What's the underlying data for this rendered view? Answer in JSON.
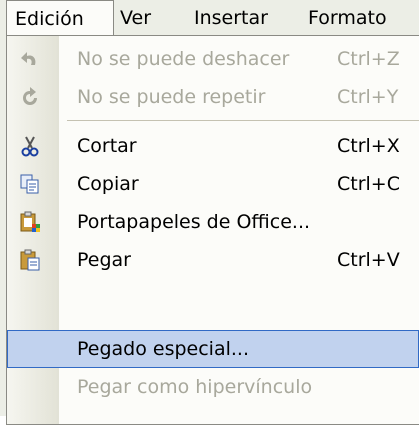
{
  "menubar": {
    "items": [
      {
        "label": "Edición"
      },
      {
        "label": "Ver"
      },
      {
        "label": "Insertar"
      },
      {
        "label": "Formato"
      }
    ]
  },
  "menu": {
    "items": [
      {
        "label": "No se puede deshacer",
        "shortcut": "Ctrl+Z",
        "icon": "undo-icon",
        "enabled": false
      },
      {
        "label": "No se puede repetir",
        "shortcut": "Ctrl+Y",
        "icon": "redo-icon",
        "enabled": false
      },
      {
        "label": "Cortar",
        "shortcut": "Ctrl+X",
        "icon": "scissors-icon",
        "enabled": true
      },
      {
        "label": "Copiar",
        "shortcut": "Ctrl+C",
        "icon": "copy-icon",
        "enabled": true
      },
      {
        "label": "Portapapeles de Office...",
        "shortcut": "",
        "icon": "office-clipboard-icon",
        "enabled": true
      },
      {
        "label": "Pegar",
        "shortcut": "Ctrl+V",
        "icon": "paste-icon",
        "enabled": true
      },
      {
        "label": "Pegado especial...",
        "shortcut": "",
        "icon": "",
        "enabled": true,
        "highlighted": true
      },
      {
        "label": "Pegar como hipervínculo",
        "shortcut": "",
        "icon": "",
        "enabled": false
      }
    ]
  },
  "colors": {
    "menubar_bg": "#eceee6",
    "highlight_bg": "#c1d2ee",
    "highlight_border": "#316ac5",
    "disabled_text": "#a8a89c"
  }
}
